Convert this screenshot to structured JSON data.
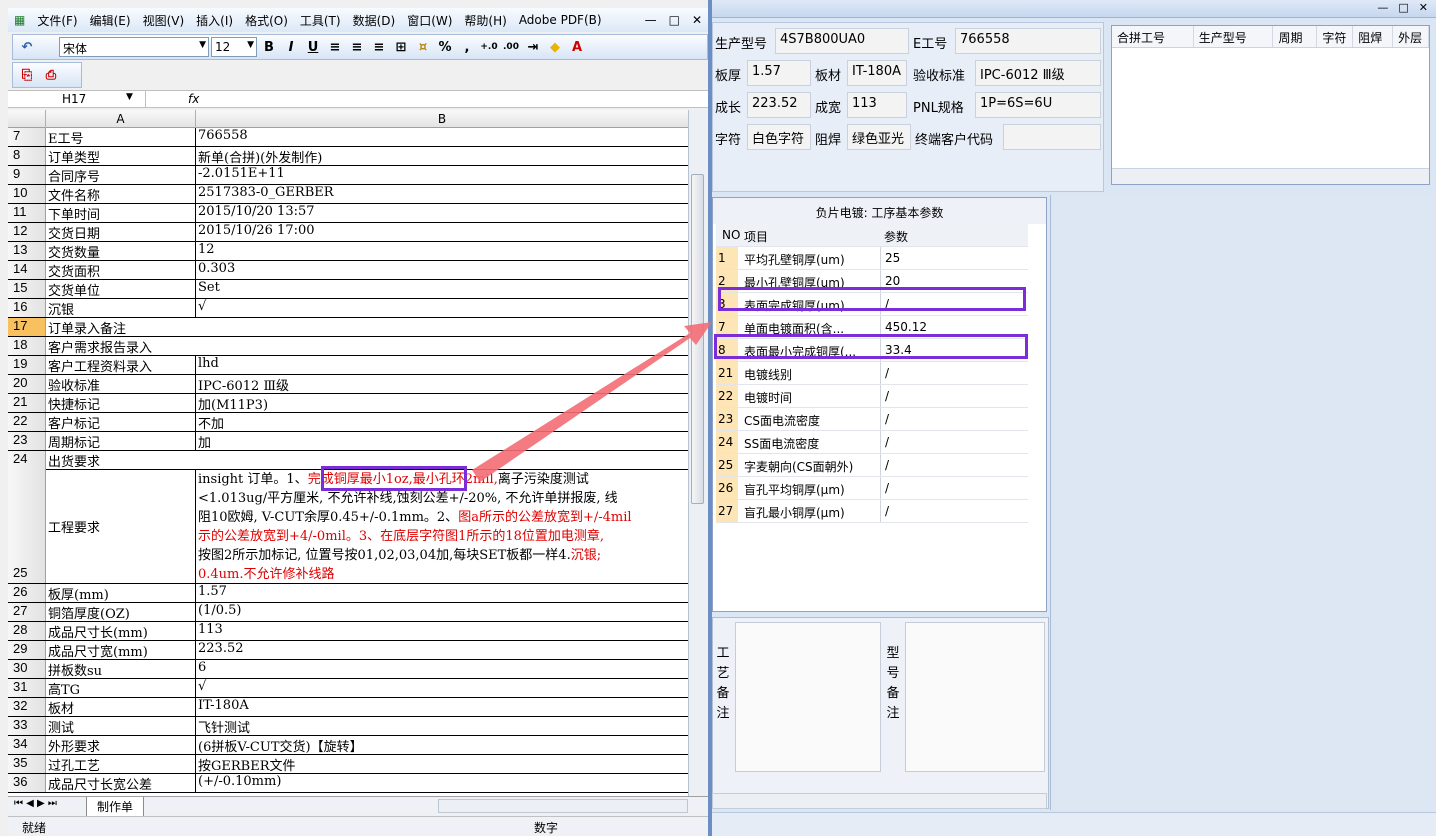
{
  "bg": {
    "window_buttons": [
      "—",
      "□",
      "✕"
    ],
    "mdi_buttons": [
      "—",
      "□",
      "✕"
    ],
    "info": {
      "prod_model_label": "生产型号",
      "prod_model": "4S7B800UA0",
      "e_job_label": "E工号",
      "e_job": "766558",
      "thickness_label": "板厚",
      "thickness": "1.57",
      "material_label": "板材",
      "material": "IT-180A",
      "standard_label": "验收标准",
      "standard": "IPC-6012 Ⅲ级",
      "length_label": "成长",
      "length": "223.52",
      "width_label": "成宽",
      "width": "113",
      "pnl_label": "PNL规格",
      "pnl": "1P=6S=6U",
      "char_label": "字符",
      "char": "白色字符",
      "mask_label": "阻焊",
      "mask": "绿色亚光",
      "endcust_label": "终端客户代码",
      "endcust": ""
    },
    "merge_headers": [
      "合拼工号",
      "生产型号",
      "周期",
      "字符",
      "阻焊",
      "外层"
    ],
    "proc": {
      "title": "负片电镀: 工序基本参数",
      "head_no": "NO",
      "head_item": "项目",
      "head_param": "参数",
      "rows": [
        {
          "no": "1",
          "item": "平均孔壁铜厚(um)",
          "val": "25"
        },
        {
          "no": "2",
          "item": "最小孔壁铜厚(um)",
          "val": "20"
        },
        {
          "no": "3",
          "item": "表面完成铜厚(um)",
          "val": "/"
        },
        {
          "no": "7",
          "item": "单面电镀面积(含...",
          "val": "450.12"
        },
        {
          "no": "8",
          "item": "表面最小完成铜厚(...",
          "val": "33.4"
        },
        {
          "no": "21",
          "item": "电镀线别",
          "val": "/"
        },
        {
          "no": "22",
          "item": "电镀时间",
          "val": "/"
        },
        {
          "no": "23",
          "item": "CS面电流密度",
          "val": "/"
        },
        {
          "no": "24",
          "item": "SS面电流密度",
          "val": "/"
        },
        {
          "no": "25",
          "item": "字麦朝向(CS面朝外)",
          "val": "/"
        },
        {
          "no": "26",
          "item": "盲孔平均铜厚(μm)",
          "val": "/"
        },
        {
          "no": "27",
          "item": "盲孔最小铜厚(μm)",
          "val": "/"
        }
      ]
    },
    "remark1": "工艺备注",
    "remark2": "型号备注"
  },
  "excel": {
    "menu": [
      "文件(F)",
      "编辑(E)",
      "视图(V)",
      "插入(I)",
      "格式(O)",
      "工具(T)",
      "数据(D)",
      "窗口(W)",
      "帮助(H)",
      "Adobe PDF(B)"
    ],
    "font": "宋体",
    "size": "12",
    "namebox": "H17",
    "fx": "fx",
    "col_a": "A",
    "col_b": "B",
    "rows": [
      {
        "n": "7",
        "a": "E工号",
        "b": "766558"
      },
      {
        "n": "8",
        "a": "订单类型",
        "b": "新单(合拼)(外发制作)"
      },
      {
        "n": "9",
        "a": "合同序号",
        "b": "-2.0151E+11"
      },
      {
        "n": "10",
        "a": "文件名称",
        "b": "2517383-0_GERBER"
      },
      {
        "n": "11",
        "a": "下单时间",
        "b": "2015/10/20 13:57"
      },
      {
        "n": "12",
        "a": "交货日期",
        "b": "2015/10/26 17:00"
      },
      {
        "n": "13",
        "a": "交货数量",
        "b": "12"
      },
      {
        "n": "14",
        "a": "交货面积",
        "b": "0.303"
      },
      {
        "n": "15",
        "a": "交货单位",
        "b": "Set"
      },
      {
        "n": "16",
        "a": "沉银",
        "b": "√"
      },
      {
        "n": "17",
        "a": "订单录入备注",
        "b": ""
      },
      {
        "n": "18",
        "a": "客户需求报告录入",
        "b": ""
      },
      {
        "n": "19",
        "a": "客户工程资料录入",
        "b": "lhd"
      },
      {
        "n": "20",
        "a": "验收标准",
        "b": "IPC-6012 Ⅲ级"
      },
      {
        "n": "21",
        "a": "快捷标记",
        "b": "加(M11P3)"
      },
      {
        "n": "22",
        "a": "客户标记",
        "b": "不加"
      },
      {
        "n": "23",
        "a": "周期标记",
        "b": "加"
      },
      {
        "n": "24",
        "a": "出货要求",
        "b": ""
      }
    ],
    "row25": {
      "n": "25",
      "a": "工程要求",
      "l1a": "insight 订单。1、",
      "l1b": "完成铜厚最小1oz,",
      "l1c": "最小孔环2mil,",
      "l1d": "离子污染度测试",
      "l2": "<1.013ug/平方厘米, 不允许补线,蚀刻公差+/-20%, 不允许单拼报废, 线",
      "l3": "阻10欧姆, V-CUT余厚0.45+/-0.1mm。2、",
      "l3b": "图a所示的公差放宽到+/-4mil",
      "l4": "示的公差放宽到+4/-0mil。3、在底层字符图1所示的18位置加电测章,",
      "l5": "按图2所示加标记, 位置号按01,02,03,04加,每块SET板都一样4.",
      "l5b": "沉银;",
      "l6": "0.4um.不允许修补线路"
    },
    "rows2": [
      {
        "n": "26",
        "a": "板厚(mm)",
        "b": "1.57"
      },
      {
        "n": "27",
        "a": "铜箔厚度(OZ)",
        "b": "(1/0.5)"
      },
      {
        "n": "28",
        "a": "成品尺寸长(mm)",
        "b": "113"
      },
      {
        "n": "29",
        "a": "成品尺寸宽(mm)",
        "b": "223.52"
      },
      {
        "n": "30",
        "a": "拼板数su",
        "b": "6"
      },
      {
        "n": "31",
        "a": "高TG",
        "b": "√"
      },
      {
        "n": "32",
        "a": "板材",
        "b": "IT-180A"
      },
      {
        "n": "33",
        "a": "测试",
        "b": "飞针测试"
      },
      {
        "n": "34",
        "a": "外形要求",
        "b": "(6拼板V-CUT交货)【旋转】"
      },
      {
        "n": "35",
        "a": "过孔工艺",
        "b": "按GERBER文件"
      },
      {
        "n": "36",
        "a": "成品尺寸长宽公差",
        "b": "(+/-0.10mm)"
      }
    ],
    "sheet": "制作单",
    "status_ready": "就绪",
    "status_num": "数字"
  }
}
